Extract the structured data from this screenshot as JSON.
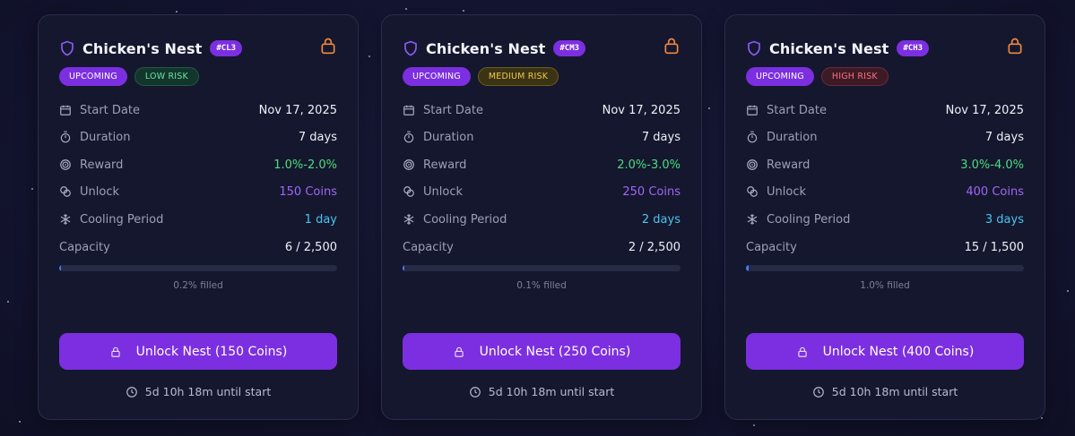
{
  "colors": {
    "accent": "#7c2fe0",
    "lock_orange": "#f0883e",
    "green": "#4ade80",
    "purple": "#a166f6",
    "cyan": "#46c6ee",
    "bar_fill": "#3b82f6"
  },
  "labels": {
    "start_date": "Start Date",
    "duration": "Duration",
    "reward": "Reward",
    "unlock": "Unlock",
    "cooling": "Cooling Period",
    "capacity": "Capacity"
  },
  "icons": {
    "title": "shield-icon",
    "header_lock": "lock-icon",
    "start_date": "calendar-icon",
    "duration": "stopwatch-icon",
    "reward": "target-icon",
    "unlock": "coins-icon",
    "cooling": "snowflake-icon",
    "button": "lock-icon",
    "countdown": "clock-icon"
  },
  "cards": [
    {
      "title": "Chicken's Nest",
      "code": "#CL3",
      "status": "UPCOMING",
      "risk": "LOW RISK",
      "start_date": "Nov 17, 2025",
      "duration": "7 days",
      "reward": "1.0%-2.0%",
      "unlock": "150 Coins",
      "cooling": "1 day",
      "capacity": "6 / 2,500",
      "fill_percent": 0.2,
      "filled_text": "0.2% filled",
      "button": "Unlock Nest (150 Coins)",
      "countdown": "5d 10h 18m until start"
    },
    {
      "title": "Chicken's Nest",
      "code": "#CM3",
      "status": "UPCOMING",
      "risk": "MEDIUM RISK",
      "start_date": "Nov 17, 2025",
      "duration": "7 days",
      "reward": "2.0%-3.0%",
      "unlock": "250 Coins",
      "cooling": "2 days",
      "capacity": "2 / 2,500",
      "fill_percent": 0.1,
      "filled_text": "0.1% filled",
      "button": "Unlock Nest (250 Coins)",
      "countdown": "5d 10h 18m until start"
    },
    {
      "title": "Chicken's Nest",
      "code": "#CH3",
      "status": "UPCOMING",
      "risk": "HIGH RISK",
      "start_date": "Nov 17, 2025",
      "duration": "7 days",
      "reward": "3.0%-4.0%",
      "unlock": "400 Coins",
      "cooling": "3 days",
      "capacity": "15 / 1,500",
      "fill_percent": 1.0,
      "filled_text": "1.0% filled",
      "button": "Unlock Nest (400 Coins)",
      "countdown": "5d 10h 18m until start"
    }
  ]
}
